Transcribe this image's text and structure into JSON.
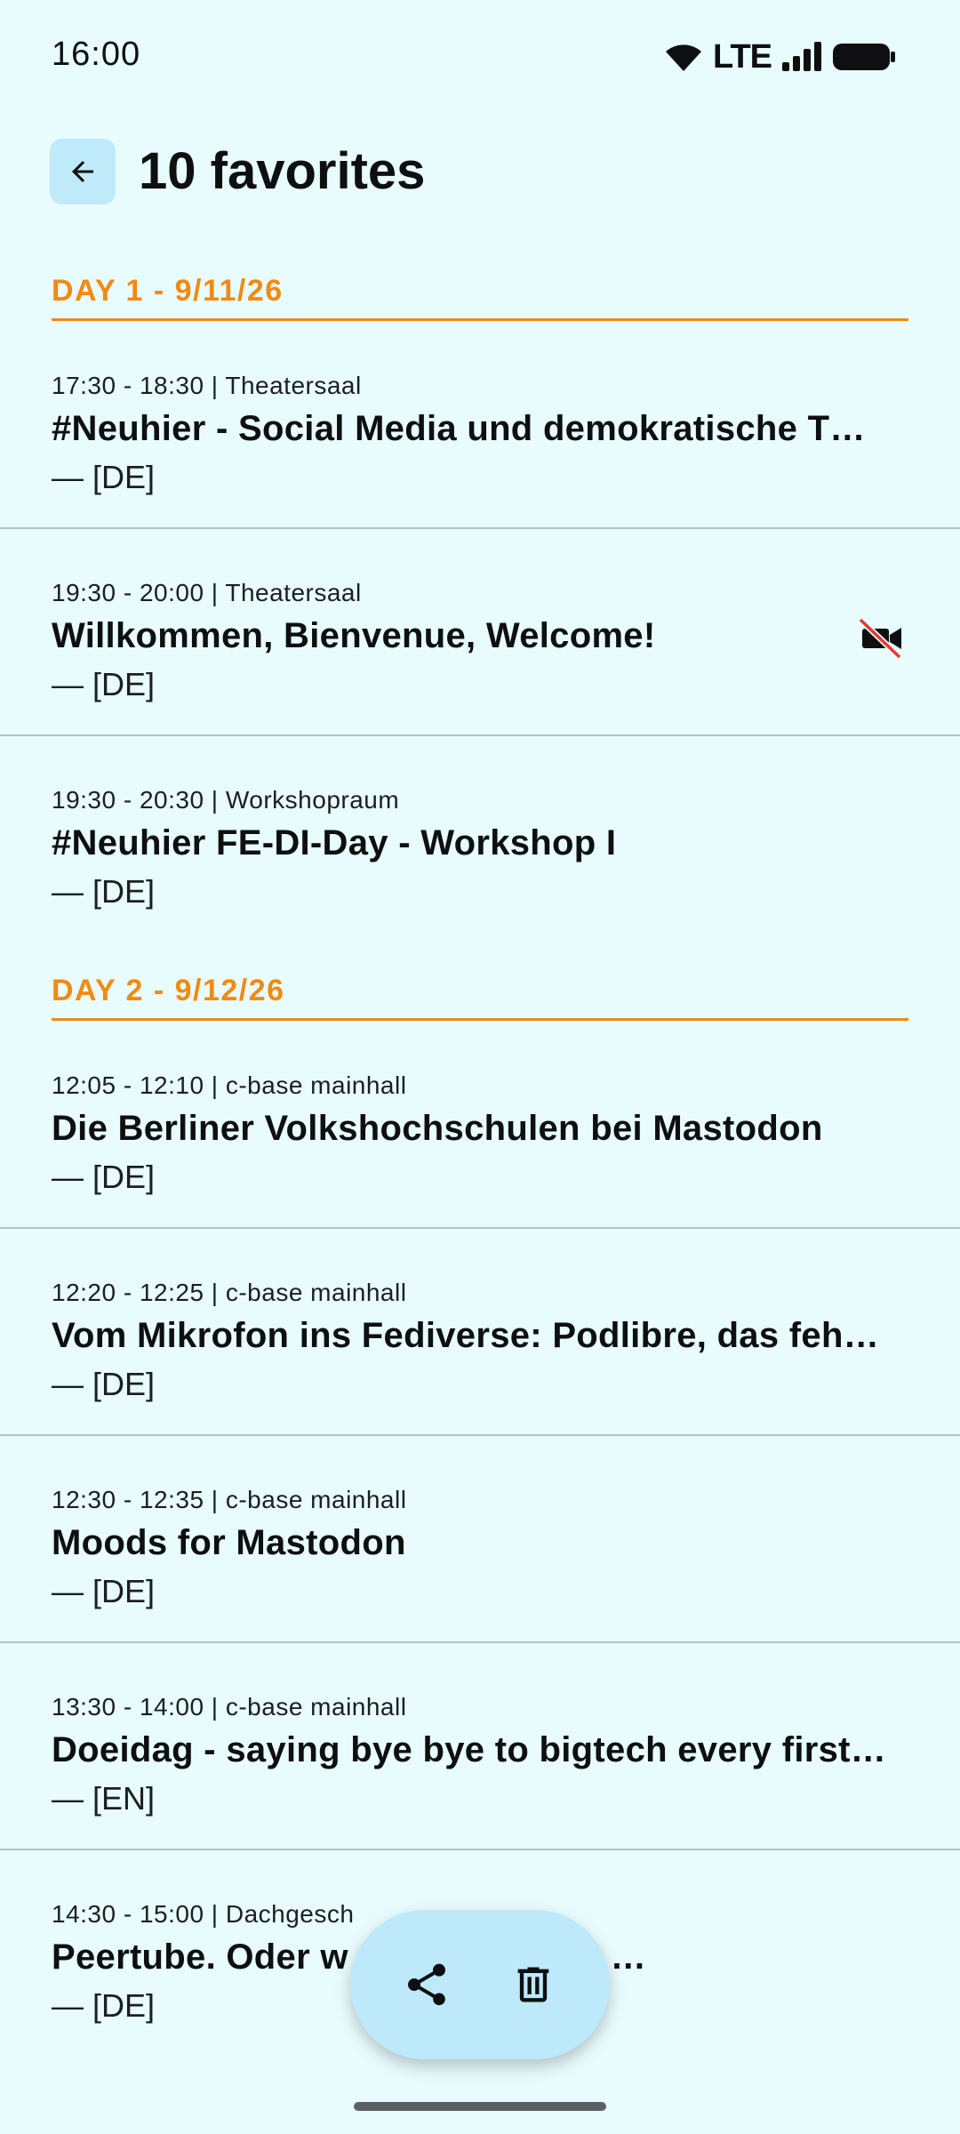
{
  "status_bar": {
    "time": "16:00",
    "network": "LTE"
  },
  "app_bar": {
    "title": "10 favorites"
  },
  "days": [
    {
      "label": "DAY 1 - 9/11/26",
      "sessions": [
        {
          "meta": "17:30 - 18:30 | Theatersaal",
          "title": "#Neuhier - Social Media und demokratische T…",
          "lang": "— [DE]",
          "no_video": false
        },
        {
          "meta": "19:30 - 20:00 | Theatersaal",
          "title": "Willkommen, Bienvenue, Welcome!",
          "lang": "— [DE]",
          "no_video": true
        },
        {
          "meta": "19:30 - 20:30 | Workshopraum",
          "title": "#Neuhier FE-DI-Day - Workshop I",
          "lang": "— [DE]",
          "no_video": false
        }
      ]
    },
    {
      "label": "DAY 2 - 9/12/26",
      "sessions": [
        {
          "meta": "12:05 - 12:10 | c-base mainhall",
          "title": "Die Berliner Volkshochschulen bei Mastodon",
          "lang": "— [DE]",
          "no_video": false
        },
        {
          "meta": "12:20 - 12:25 | c-base mainhall",
          "title": "Vom Mikrofon ins Fediverse: Podlibre, das feh…",
          "lang": "— [DE]",
          "no_video": false
        },
        {
          "meta": "12:30 - 12:35 | c-base mainhall",
          "title": "Moods for Mastodon",
          "lang": "— [DE]",
          "no_video": false
        },
        {
          "meta": "13:30 - 14:00 | c-base mainhall",
          "title": "Doeidag - saying bye bye to bigtech every first…",
          "lang": "— [EN]",
          "no_video": false
        },
        {
          "meta": "14:30 - 15:00 | Dachgesch",
          "title": "Peertube. Oder w 00 Videos von …",
          "lang": "— [DE]",
          "no_video": false
        }
      ]
    }
  ],
  "icons": {
    "back": "arrow-back-icon",
    "no_video": "videocam-off-icon",
    "share": "share-icon",
    "delete": "trash-icon"
  },
  "colors": {
    "background": "#e8fbfd",
    "accent": "#f28a12",
    "fab": "#bde9fb",
    "no_video_slash": "#e53935"
  }
}
